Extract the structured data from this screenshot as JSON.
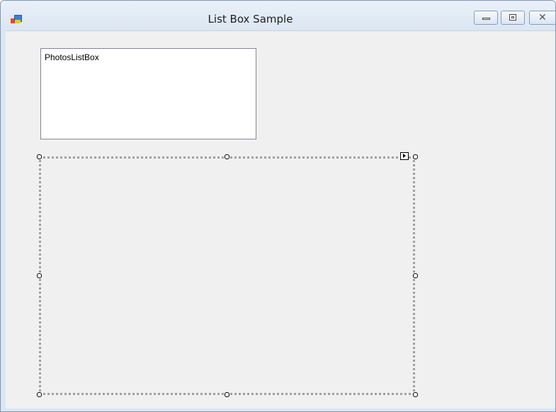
{
  "window": {
    "title": "List Box Sample",
    "controls": {
      "minimize_icon": "minimize-icon",
      "maximize_icon": "maximize-icon",
      "close_icon": "close-icon",
      "close_glyph": "✕"
    },
    "app_icon": "form-icon"
  },
  "form": {
    "listbox": {
      "items": [
        "PhotosListBox"
      ]
    },
    "picturebox": {
      "selected": true,
      "smart_tag_icon": "smart-tag-arrow-icon"
    }
  },
  "colors": {
    "form_background": "#f0f0f0",
    "frame": "#dbe6f3",
    "listbox_background": "#ffffff",
    "selection_border": "#a0a0a0"
  }
}
